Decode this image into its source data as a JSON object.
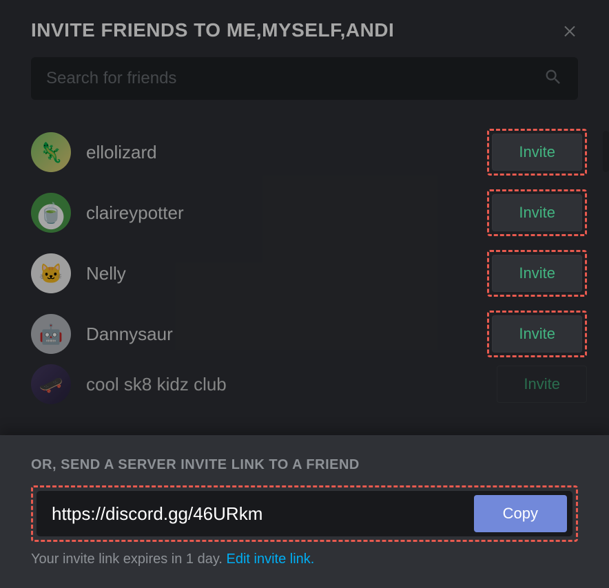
{
  "modal": {
    "title": "INVITE FRIENDS TO ME,MYSELF,ANDI",
    "search_placeholder": "Search for friends",
    "friends": [
      {
        "name": "ellolizard",
        "invite_label": "Invite"
      },
      {
        "name": "claireypotter",
        "invite_label": "Invite"
      },
      {
        "name": "Nelly",
        "invite_label": "Invite"
      },
      {
        "name": "Dannysaur",
        "invite_label": "Invite"
      },
      {
        "name": "cool sk8 kidz club",
        "invite_label": "Invite"
      }
    ],
    "footer": {
      "title": "OR, SEND A SERVER INVITE LINK TO A FRIEND",
      "link": "https://discord.gg/46URkm",
      "copy_label": "Copy",
      "expiry_text": "Your invite link expires in 1 day. ",
      "edit_link_text": "Edit invite link."
    }
  }
}
